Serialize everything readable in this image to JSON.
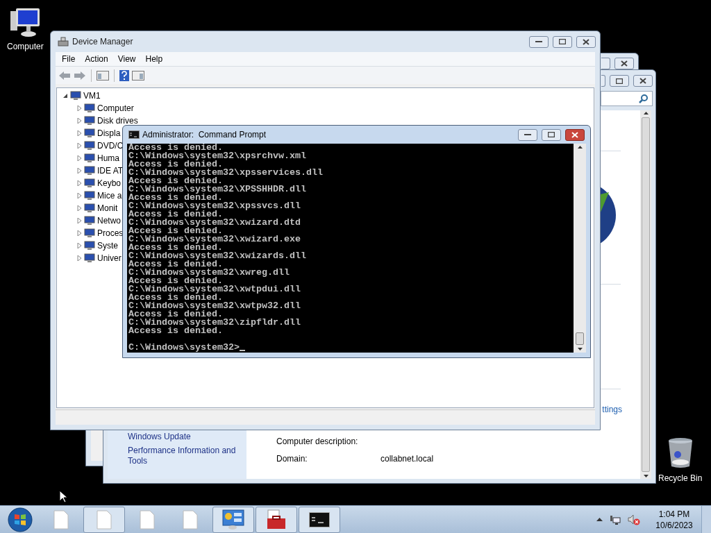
{
  "desktop_icons": [
    {
      "label": "Computer",
      "kind": "computer"
    },
    {
      "label": "Recycle Bin",
      "kind": "recycle"
    }
  ],
  "system_window": {
    "link_fragment": "ttings",
    "sidebar_links": [
      "Windows Update",
      "Performance Information and Tools"
    ],
    "fields": [
      {
        "label": "Computer description:"
      },
      {
        "label": "Domain:",
        "value": "collabnet.local"
      }
    ]
  },
  "device_manager": {
    "title": "Device Manager",
    "menu": [
      "File",
      "Action",
      "View",
      "Help"
    ],
    "tree": [
      {
        "label": "VM1",
        "expanded": true,
        "children": [
          {
            "label": "Computer",
            "expanded": false
          },
          {
            "label": "Disk drives",
            "expanded": false
          },
          {
            "label": "Displa",
            "expanded": false
          },
          {
            "label": "DVD/C",
            "expanded": false
          },
          {
            "label": "Huma",
            "expanded": false
          },
          {
            "label": "IDE AT",
            "expanded": false
          },
          {
            "label": "Keybo",
            "expanded": false
          },
          {
            "label": "Mice a",
            "expanded": false
          },
          {
            "label": "Monit",
            "expanded": false
          },
          {
            "label": "Netwo",
            "expanded": false
          },
          {
            "label": "Proces",
            "expanded": false
          },
          {
            "label": "Syste",
            "expanded": false
          },
          {
            "label": "Univer",
            "expanded": false
          }
        ]
      }
    ]
  },
  "command_prompt": {
    "title": "Administrator:  Command Prompt",
    "lines": [
      "Access is denied.",
      "C:\\Windows\\system32\\xpsrchvw.xml",
      "Access is denied.",
      "C:\\Windows\\system32\\xpsservices.dll",
      "Access is denied.",
      "C:\\Windows\\system32\\XPSSHHDR.dll",
      "Access is denied.",
      "C:\\Windows\\system32\\xpssvcs.dll",
      "Access is denied.",
      "C:\\Windows\\system32\\xwizard.dtd",
      "Access is denied.",
      "C:\\Windows\\system32\\xwizard.exe",
      "Access is denied.",
      "C:\\Windows\\system32\\xwizards.dll",
      "Access is denied.",
      "C:\\Windows\\system32\\xwreg.dll",
      "Access is denied.",
      "C:\\Windows\\system32\\xwtpdui.dll",
      "Access is denied.",
      "C:\\Windows\\system32\\xwtpw32.dll",
      "Access is denied.",
      "C:\\Windows\\system32\\zipfldr.dll",
      "Access is denied."
    ],
    "prompt": "C:\\Windows\\system32>"
  },
  "taskbar": {
    "buttons": [
      {
        "kind": "file",
        "running": false
      },
      {
        "kind": "file",
        "running": true
      },
      {
        "kind": "file",
        "running": false
      },
      {
        "kind": "file",
        "running": false
      },
      {
        "kind": "control-panel",
        "running": true
      },
      {
        "kind": "toolbox",
        "running": true
      },
      {
        "kind": "console",
        "running": true
      }
    ],
    "clock": {
      "time": "1:04 PM",
      "date": "10/6/2023"
    }
  }
}
